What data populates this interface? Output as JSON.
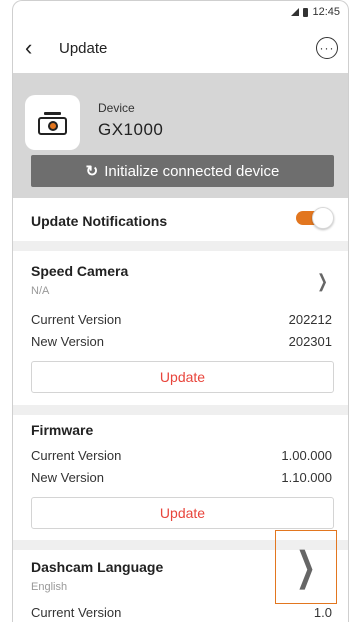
{
  "status_bar": {
    "time": "12:45"
  },
  "header": {
    "title": "Update",
    "back_icon": "chevron-left-icon",
    "more_icon": "more-icon"
  },
  "device": {
    "label": "Device",
    "name": "GX1000",
    "initialize_label": "Initialize connected device"
  },
  "notifications": {
    "label": "Update Notifications",
    "enabled": true
  },
  "speed_camera": {
    "title": "Speed Camera",
    "status": "N/A",
    "current_label": "Current Version",
    "current_value": "202212",
    "new_label": "New Version",
    "new_value": "202301",
    "update_label": "Update"
  },
  "firmware": {
    "title": "Firmware",
    "current_label": "Current Version",
    "current_value": "1.00.000",
    "new_label": "New Version",
    "new_value": "1.10.000",
    "update_label": "Update"
  },
  "dashcam_language": {
    "title": "Dashcam Language",
    "value": "English",
    "current_label": "Current Version",
    "current_value": "1.0"
  },
  "colors": {
    "accent": "#e2761f",
    "update_text": "#e8453c",
    "device_panel": "#d6d6d6"
  }
}
